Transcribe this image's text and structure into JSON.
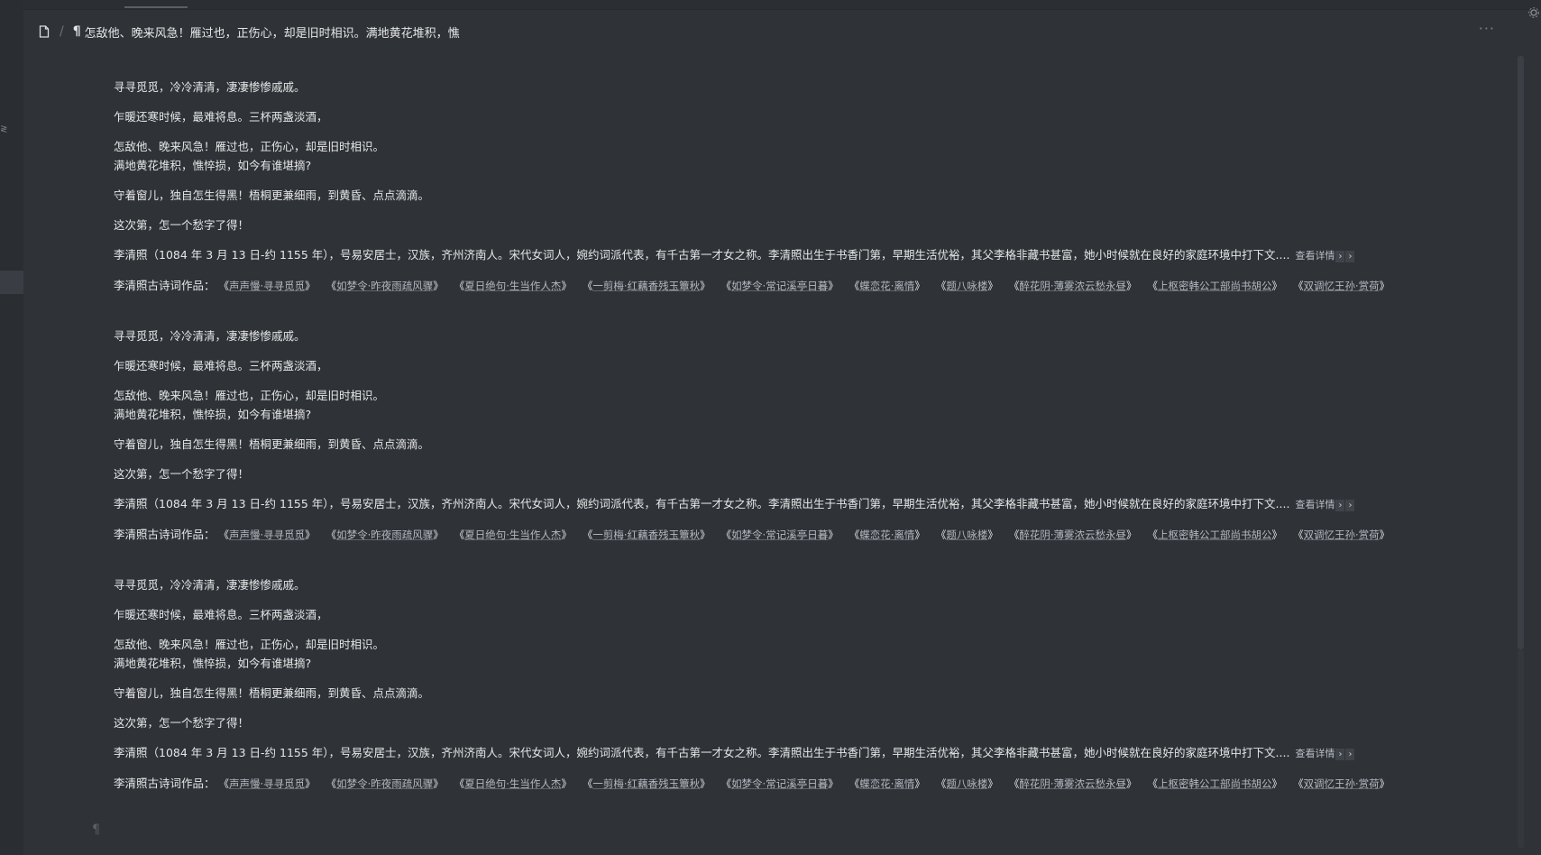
{
  "header": {
    "breadcrumb_separator": "/",
    "pilcrow": "¶",
    "title": "怎敌他、晚来风急！雁过也，正伤心，却是旧时相识。满地黄花堆积，憔",
    "more": "···"
  },
  "icons": {
    "doc": "document-icon",
    "more": "more-horizontal-icon",
    "corner": "settings-icon"
  },
  "poem": {
    "line1": "寻寻觅觅，冷冷清清，凄凄惨惨戚戚。",
    "line2": "乍暖还寒时候，最难将息。三杯两盏淡酒，",
    "line3": "怎敌他、晚来风急！雁过也，正伤心，却是旧时相识。",
    "line4": "满地黄花堆积，憔悴损，如今有谁堪摘?",
    "line5": "守着窗儿，独自怎生得黑！梧桐更兼细雨，到黄昏、点点滴滴。",
    "line6": "这次第，怎一个愁字了得！"
  },
  "bio": {
    "text": "李清照（1084 年 3 月 13 日-约 1155 年），号易安居士，汉族，齐州济南人。宋代女词人，婉约词派代表，有千古第一才女之称。李清照出生于书香门第，早期生活优裕，其父李格非藏书甚富，她小时候就在良好的家庭环境中打下文....",
    "more_label": "查看详情",
    "chevron": "›"
  },
  "works": {
    "label": "李清照古诗词作品：",
    "open": "《",
    "close": "》",
    "items": [
      "声声慢·寻寻觅觅",
      "如梦令·昨夜雨疏风骤",
      "夏日绝句·生当作人杰",
      "一剪梅·红藕香残玉簟秋",
      "如梦令·常记溪亭日暮",
      "蝶恋花·离情",
      "题八咏楼",
      "醉花阴·薄雾浓云愁永昼",
      "上枢密韩公工部尚书胡公",
      "双调忆王孙·赏荷"
    ]
  },
  "end_marker": "¶",
  "left_rail_tick": "≷"
}
